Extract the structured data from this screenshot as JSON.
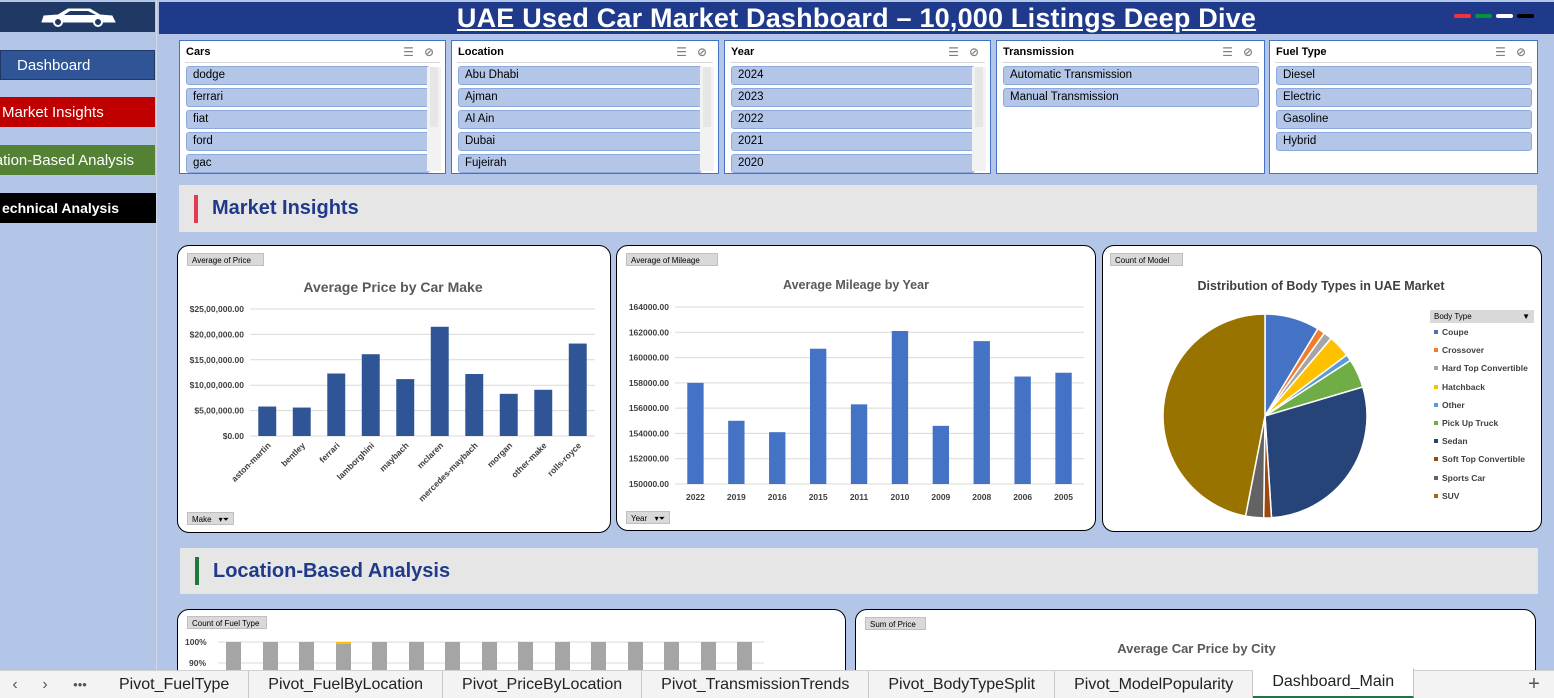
{
  "sidebar": {
    "items": [
      {
        "label": "Dashboard"
      },
      {
        "label": "Market Insights"
      },
      {
        "label": "ation-Based Analysis"
      },
      {
        "label": "echnical Analysis"
      }
    ]
  },
  "header": {
    "title": "UAE Used Car Market Dashboard – 10,000 Listings Deep Dive",
    "flag_colors": [
      "#ef3340",
      "#009739",
      "#ffffff",
      "#000000"
    ]
  },
  "slicers": [
    {
      "title": "Cars",
      "items": [
        "dodge",
        "ferrari",
        "fiat",
        "ford",
        "gac"
      ],
      "scroll": true
    },
    {
      "title": "Location",
      "items": [
        "Abu Dhabi",
        "Ajman",
        "Al Ain",
        "Dubai",
        "Fujeirah"
      ],
      "scroll": true
    },
    {
      "title": "Year",
      "items": [
        "2024",
        "2023",
        "2022",
        "2021",
        "2020"
      ],
      "scroll": true
    },
    {
      "title": "Transmission",
      "items": [
        "Automatic Transmission",
        "Manual Transmission"
      ],
      "scroll": false
    },
    {
      "title": "Fuel Type",
      "items": [
        "Diesel",
        "Electric",
        "Gasoline",
        "Hybrid"
      ],
      "scroll": false
    }
  ],
  "sections": {
    "market": {
      "label": "Market Insights",
      "accent": "#e03c4f"
    },
    "location": {
      "label": "Location-Based Analysis",
      "accent": "#1e7a3c"
    }
  },
  "charts": {
    "price_by_make": {
      "field": "Average of Price",
      "axis_field": "Make"
    },
    "mileage_by_year": {
      "field": "Average of Mileage",
      "axis_field": "Year"
    },
    "body_types": {
      "field": "Count of Model",
      "legend_field": "Body Type"
    },
    "fuel_by_location": {
      "field": "Count of Fuel Type",
      "yticks": [
        "100%",
        "90%"
      ]
    },
    "price_by_city": {
      "field": "Sum of Price",
      "title": "Average Car Price by City"
    }
  },
  "chart_data": [
    {
      "type": "bar",
      "title": "Average Price by Car Make",
      "categories": [
        "aston-martin",
        "bentley",
        "ferrari",
        "lamborghini",
        "maybach",
        "mclaren",
        "mercedes-maybach",
        "morgan",
        "other-make",
        "rolls-royce"
      ],
      "values": [
        580000,
        560000,
        1230000,
        1610000,
        1120000,
        2150000,
        1220000,
        830000,
        910000,
        1820000
      ],
      "yticks": [
        "$25,00,000.00",
        "$20,00,000.00",
        "$15,00,000.00",
        "$10,00,000.00",
        "$5,00,000.00",
        "$0.00"
      ],
      "ylim": [
        0,
        2500000
      ],
      "color": "#2f5597"
    },
    {
      "type": "bar",
      "title": "Average Mileage by Year",
      "categories": [
        "2022",
        "2019",
        "2016",
        "2015",
        "2011",
        "2010",
        "2009",
        "2008",
        "2006",
        "2005"
      ],
      "values": [
        158000,
        155000,
        154100,
        160700,
        156300,
        162100,
        154600,
        161300,
        158500,
        158800
      ],
      "yticks": [
        "164000.00",
        "162000.00",
        "160000.00",
        "158000.00",
        "156000.00",
        "154000.00",
        "152000.00",
        "150000.00"
      ],
      "ylim": [
        150000,
        164000
      ],
      "color": "#4472c4"
    },
    {
      "type": "pie",
      "title": "Distribution of Body Types in UAE Market",
      "labels": [
        "Coupe",
        "Crossover",
        "Hard Top Convertible",
        "Hatchback",
        "Other",
        "Pick Up Truck",
        "Sedan",
        "Soft Top Convertible",
        "Sports Car",
        "SUV"
      ],
      "colors": [
        "#4472c4",
        "#ed7d31",
        "#a5a5a5",
        "#ffc000",
        "#5b9bd5",
        "#70ad47",
        "#264478",
        "#9e480e",
        "#636363",
        "#997300"
      ],
      "values": [
        8.5,
        1.2,
        1.3,
        3.5,
        1.0,
        4.5,
        28.0,
        1.2,
        2.8,
        46.0
      ]
    }
  ],
  "tabs": {
    "items": [
      "Pivot_FuelType",
      "Pivot_FuelByLocation",
      "Pivot_PriceByLocation",
      "Pivot_TransmissionTrends",
      "Pivot_BodyTypeSplit",
      "Pivot_ModelPopularity",
      "Dashboard_Main"
    ],
    "active": "Dashboard_Main",
    "more": "•••",
    "add": "+"
  }
}
